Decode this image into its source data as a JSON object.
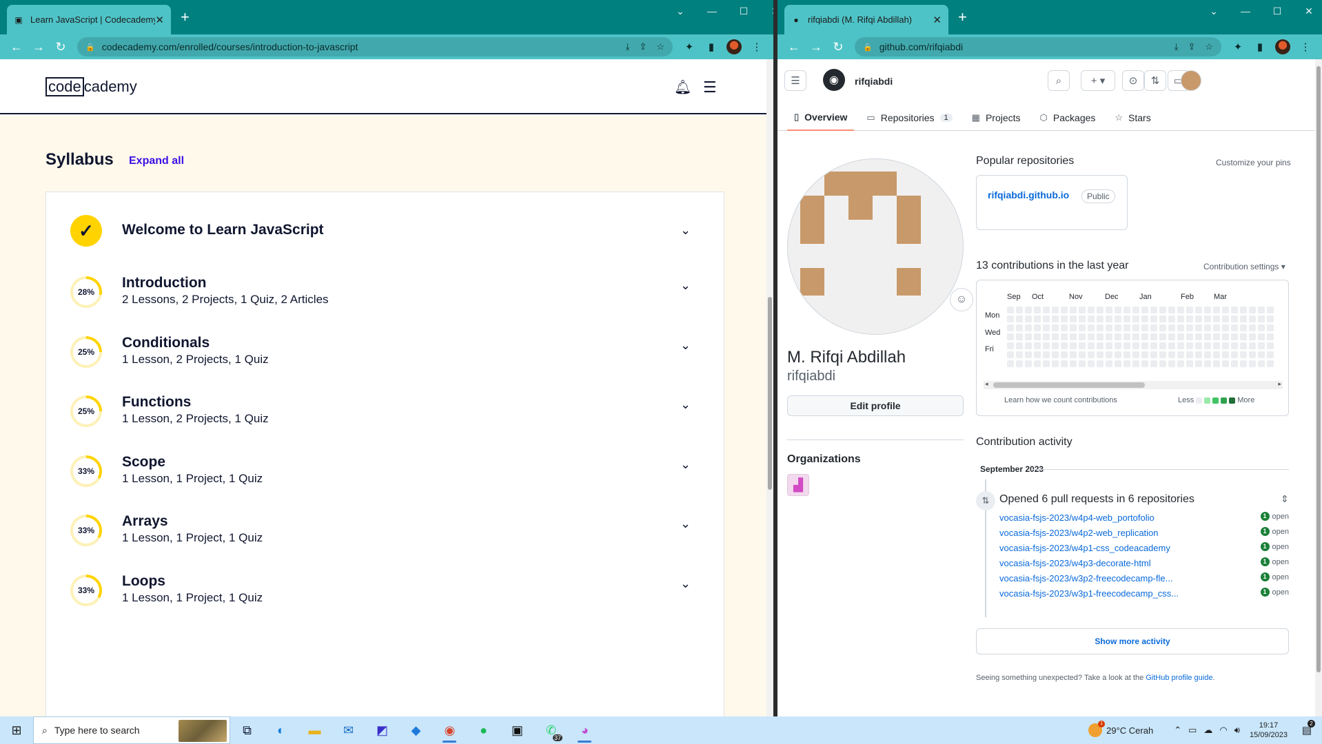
{
  "left_window": {
    "tab_title": "Learn JavaScript | Codecademy",
    "url": "codecademy.com/enrolled/courses/introduction-to-javascript",
    "logo_part1": "code",
    "logo_part2": "cademy",
    "syllabus_title": "Syllabus",
    "expand_all": "Expand all",
    "modules": [
      {
        "title": "Welcome to Learn JavaScript",
        "summary": "",
        "progress": "",
        "completed": true
      },
      {
        "title": "Introduction",
        "summary": "2 Lessons, 2 Projects, 1 Quiz, 2 Articles",
        "progress": "28%",
        "completed": false
      },
      {
        "title": "Conditionals",
        "summary": "1 Lesson, 2 Projects, 1 Quiz",
        "progress": "25%",
        "completed": false
      },
      {
        "title": "Functions",
        "summary": "1 Lesson, 2 Projects, 1 Quiz",
        "progress": "25%",
        "completed": false
      },
      {
        "title": "Scope",
        "summary": "1 Lesson, 1 Project, 1 Quiz",
        "progress": "33%",
        "completed": false
      },
      {
        "title": "Arrays",
        "summary": "1 Lesson, 1 Project, 1 Quiz",
        "progress": "33%",
        "completed": false
      },
      {
        "title": "Loops",
        "summary": "1 Lesson, 1 Project, 1 Quiz",
        "progress": "33%",
        "completed": false
      }
    ]
  },
  "right_window": {
    "tab_title": "rifqiabdi (M. Rifqi Abdillah)",
    "url": "github.com/rifqiabdi",
    "username": "rifqiabdi",
    "tabs": [
      {
        "label": "Overview",
        "icon": "book-icon"
      },
      {
        "label": "Repositories",
        "icon": "repo-icon",
        "count": "1"
      },
      {
        "label": "Projects",
        "icon": "table-icon"
      },
      {
        "label": "Packages",
        "icon": "package-icon"
      },
      {
        "label": "Stars",
        "icon": "star-icon"
      }
    ],
    "full_name": "M. Rifqi Abdillah",
    "login": "rifqiabdi",
    "edit_profile": "Edit profile",
    "organizations_title": "Organizations",
    "popular_title": "Popular repositories",
    "customize_pins": "Customize your pins",
    "pinned_repo": {
      "name": "rifqiabdi.github.io",
      "visibility": "Public"
    },
    "contributions_title": "13 contributions in the last year",
    "contribution_settings": "Contribution settings ▾",
    "graph_months": [
      "Sep",
      "Oct",
      "Nov",
      "Dec",
      "Jan",
      "Feb",
      "Mar"
    ],
    "graph_days": [
      "Mon",
      "Wed",
      "Fri"
    ],
    "learn_link": "Learn how we count contributions",
    "legend_less": "Less",
    "legend_more": "More",
    "activity_title": "Contribution activity",
    "activity_month": "September 2023",
    "pr_summary": "Opened 6 pull requests in 6 repositories",
    "pull_requests": [
      {
        "repo": "vocasia-fsjs-2023/w4p4-web_portofolio",
        "count": "1",
        "status": "open"
      },
      {
        "repo": "vocasia-fsjs-2023/w4p2-web_replication",
        "count": "1",
        "status": "open"
      },
      {
        "repo": "vocasia-fsjs-2023/w4p1-css_codeacademy",
        "count": "1",
        "status": "open"
      },
      {
        "repo": "vocasia-fsjs-2023/w4p3-decorate-html",
        "count": "1",
        "status": "open"
      },
      {
        "repo": "vocasia-fsjs-2023/w3p2-freecodecamp-fle...",
        "count": "1",
        "status": "open"
      },
      {
        "repo": "vocasia-fsjs-2023/w3p1-freecodecamp_css...",
        "count": "1",
        "status": "open"
      }
    ],
    "show_more": "Show more activity",
    "unexpected_text": "Seeing something unexpected? Take a look at the ",
    "unexpected_link": "GitHub profile guide",
    "unexpected_end": "."
  },
  "taskbar": {
    "search_placeholder": "Type here to search",
    "whatsapp_badge": "37",
    "weather": "29°C  Cerah",
    "weather_badge": "1",
    "time": "19:17",
    "date": "15/09/2023",
    "notification_badge": "2"
  }
}
